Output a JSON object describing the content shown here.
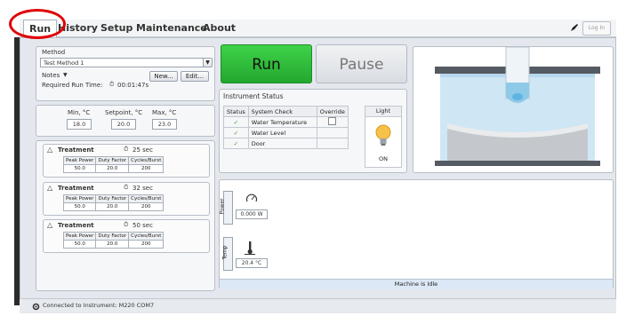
{
  "menu": {
    "tabs": [
      "Run",
      "History",
      "Setup",
      "Maintenance",
      "About"
    ],
    "login_label": "Log In"
  },
  "method": {
    "label": "Method",
    "selected": "Test Method 1",
    "new_button": "New...",
    "edit_button": "Edit...",
    "notes_label": "Notes",
    "required_run_time_label": "Required Run Time:",
    "required_run_time_value": "00:01:47s"
  },
  "temperature": {
    "min_label": "Min, °C",
    "setpoint_label": "Setpoint, °C",
    "max_label": "Max, °C",
    "min_value": "18.0",
    "setpoint_value": "20.0",
    "max_value": "23.0"
  },
  "treatments": [
    {
      "label": "Treatment",
      "duration": "25 sec",
      "headers": [
        "Peak Power",
        "Duty Factor",
        "Cycles/Burst"
      ],
      "values": [
        "50.0",
        "20.0",
        "200"
      ]
    },
    {
      "label": "Treatment",
      "duration": "32 sec",
      "headers": [
        "Peak Power",
        "Duty Factor",
        "Cycles/Burst"
      ],
      "values": [
        "50.0",
        "20.0",
        "200"
      ]
    },
    {
      "label": "Treatment",
      "duration": "50 sec",
      "headers": [
        "Peak Power",
        "Duty Factor",
        "Cycles/Burst"
      ],
      "values": [
        "50.0",
        "20.0",
        "200"
      ]
    }
  ],
  "controls": {
    "run": "Run",
    "pause": "Pause"
  },
  "instrument_status": {
    "title": "Instrument Status",
    "headers": [
      "Status",
      "System Check",
      "Override",
      "Light"
    ],
    "checks": [
      "Water Temperature",
      "Water Level",
      "Door"
    ],
    "light_state": "ON"
  },
  "readouts": {
    "power_tab": "Power",
    "power_value": "0.000 W",
    "temp_tab": "Temp",
    "temp_value": "20.4 °C",
    "machine_status": "Machine is Idle"
  },
  "status_bar": {
    "text": "Connected to Instrument: M220 COM7"
  },
  "colors": {
    "run_green": "#2fbf3a",
    "check_green": "#3a9a2a",
    "highlight_red": "#e00000",
    "water_blue": "#cfe6f5"
  }
}
